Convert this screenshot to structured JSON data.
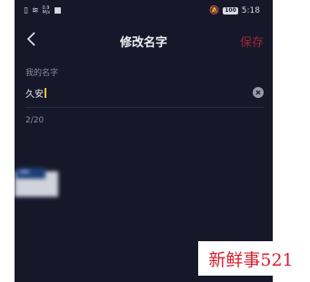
{
  "status_bar": {
    "net_speed_value": "0.9",
    "net_speed_unit": "M/s",
    "battery": "100",
    "time": "5:18"
  },
  "nav": {
    "title": "修改名字",
    "save_label": "保存"
  },
  "form": {
    "label": "我的名字",
    "value": "久安",
    "char_count": "2/20"
  },
  "watermark": "新鲜事521",
  "colors": {
    "background": "#16182a",
    "save_accent": "#9a2a36",
    "caret": "#e8c23a",
    "watermark_text": "#d81e2c"
  }
}
